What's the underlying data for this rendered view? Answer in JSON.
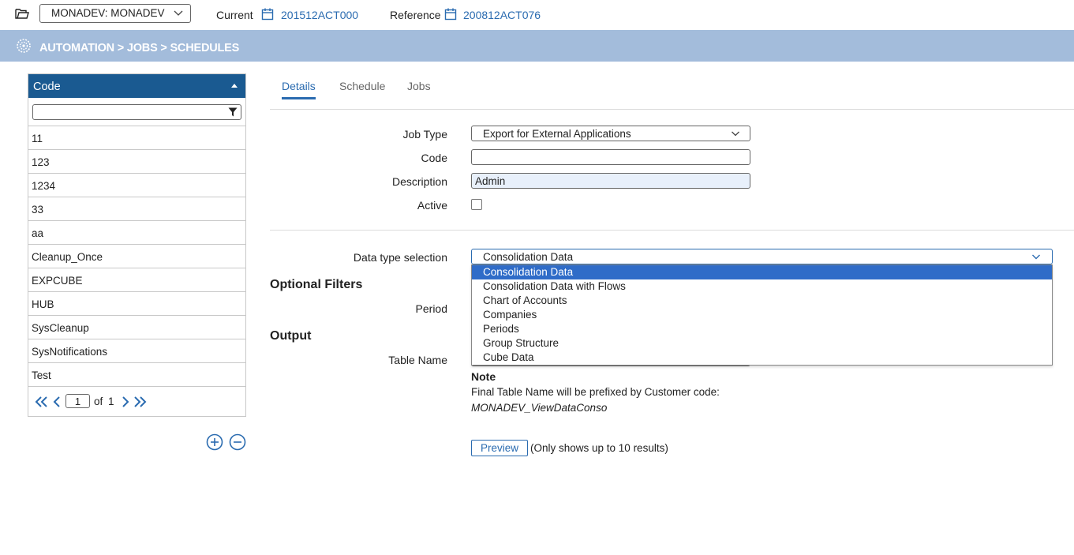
{
  "topbar": {
    "environment": "MONADEV: MONADEV",
    "current_label": "Current",
    "current_value": "201512ACT000",
    "reference_label": "Reference",
    "reference_value": "200812ACT076"
  },
  "breadcrumb": "AUTOMATION > JOBS > SCHEDULES",
  "list": {
    "header": "Code",
    "filter_value": "",
    "rows": [
      "11",
      "123",
      "1234",
      "33",
      "aa",
      "Cleanup_Once",
      "EXPCUBE",
      "HUB",
      "SysCleanup",
      "SysNotifications",
      "Test"
    ],
    "pager": {
      "page": "1",
      "of_label": "of",
      "total": "1"
    }
  },
  "tabs": [
    {
      "label": "Details",
      "active": true
    },
    {
      "label": "Schedule",
      "active": false
    },
    {
      "label": "Jobs",
      "active": false
    }
  ],
  "form": {
    "job_type_label": "Job Type",
    "job_type_value": "Export for External Applications",
    "code_label": "Code",
    "code_value": "",
    "description_label": "Description",
    "description_value": "Admin",
    "active_label": "Active",
    "data_type_label": "Data type selection",
    "data_type_value": "Consolidation Data",
    "data_type_options": [
      "Consolidation Data",
      "Consolidation Data with Flows",
      "Chart of Accounts",
      "Companies",
      "Periods",
      "Group Structure",
      "Cube Data"
    ],
    "optional_filters_title": "Optional Filters",
    "period_label": "Period",
    "output_title": "Output",
    "table_name_label": "Table Name",
    "note_title": "Note",
    "note_text": "Final Table Name will be prefixed by Customer code:",
    "note_code": "MONADEV_ViewDataConso",
    "preview_label": "Preview",
    "preview_note": "(Only shows up to 10 results)"
  },
  "colors": {
    "accent": "#2a6bb0",
    "band": "#a3bcdb",
    "list_header": "#1a5a91",
    "selected_option": "#2f6cc8"
  }
}
